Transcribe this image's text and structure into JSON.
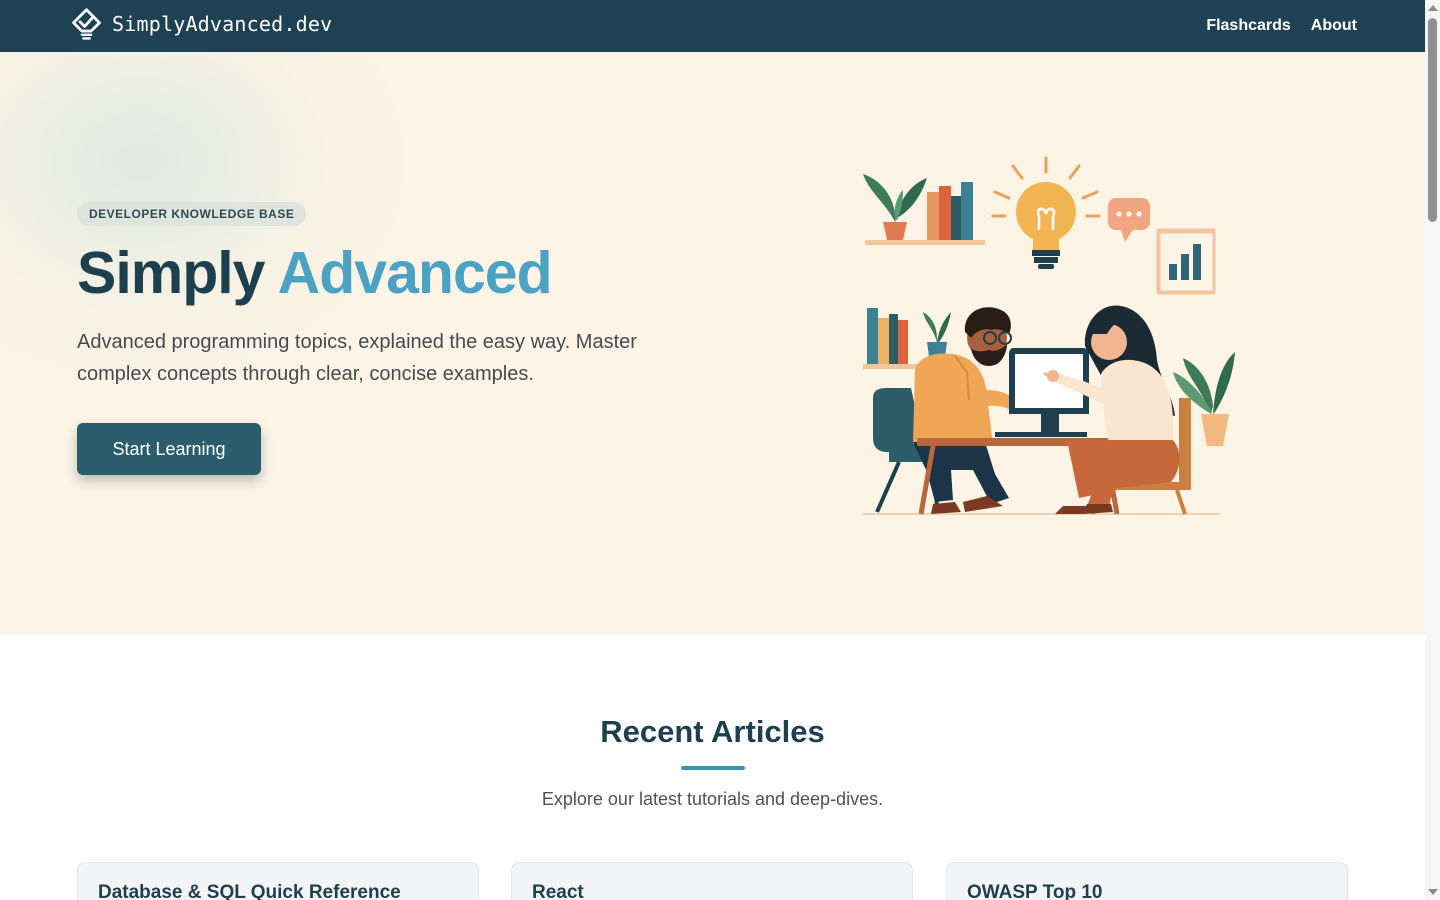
{
  "nav": {
    "brand": "SimplyAdvanced.dev",
    "logo_icon": "lightbulb-check-icon",
    "links": [
      "Flashcards",
      "About"
    ]
  },
  "hero": {
    "badge": "DEVELOPER KNOWLEDGE BASE",
    "title_part1": "Simply",
    "title_part2": "Advanced",
    "subtitle": "Advanced programming topics, explained the easy way. Master complex concepts through clear, concise examples.",
    "cta_label": "Start Learning",
    "illustration": "developers-collaborating-illustration"
  },
  "articles": {
    "heading": "Recent Articles",
    "subheading": "Explore our latest tutorials and deep-dives.",
    "cards": [
      {
        "title": "Database & SQL Quick Reference"
      },
      {
        "title": "React"
      },
      {
        "title": "OWASP Top 10"
      }
    ]
  },
  "colors": {
    "navbar": "#1e4253",
    "hero_bg": "#fdf4e6",
    "title_dark": "#1e3f4d",
    "title_accent": "#4ba2c2",
    "cta": "#2b5d6b"
  }
}
